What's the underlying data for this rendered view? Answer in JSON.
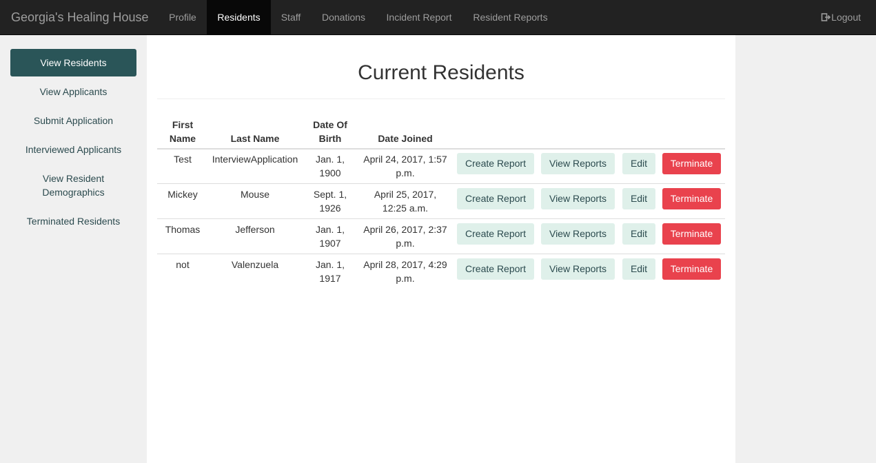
{
  "app": {
    "brand": "Georgia's Healing House"
  },
  "nav": {
    "items": [
      "Profile",
      "Residents",
      "Staff",
      "Donations",
      "Incident Report",
      "Resident Reports"
    ],
    "active": "Residents",
    "logout": "Logout"
  },
  "sidebar": {
    "items": [
      "View Residents",
      "View Applicants",
      "Submit Application",
      "Interviewed Applicants",
      "View Resident Demographics",
      "Terminated Residents"
    ],
    "active": "View Residents"
  },
  "main": {
    "title": "Current Residents",
    "table": {
      "headers": [
        "First Name",
        "Last Name",
        "Date Of Birth",
        "Date Joined"
      ],
      "rows": [
        {
          "first": "Test",
          "last": "InterviewApplication",
          "dob": "Jan. 1, 1900",
          "joined": "April 24, 2017, 1:57 p.m."
        },
        {
          "first": "Mickey",
          "last": "Mouse",
          "dob": "Sept. 1, 1926",
          "joined": "April 25, 2017, 12:25 a.m."
        },
        {
          "first": "Thomas",
          "last": "Jefferson",
          "dob": "Jan. 1, 1907",
          "joined": "April 26, 2017, 2:37 p.m."
        },
        {
          "first": "not",
          "last": "Valenzuela",
          "dob": "Jan. 1, 1917",
          "joined": "April 28, 2017, 4:29 p.m."
        }
      ],
      "actions": {
        "create": "Create Report",
        "view": "View Reports",
        "edit": "Edit",
        "terminate": "Terminate"
      }
    }
  },
  "colors": {
    "navbar": "#222222",
    "accent": "#2a5558",
    "light_button": "#dff0ea",
    "danger": "#e9424d"
  }
}
